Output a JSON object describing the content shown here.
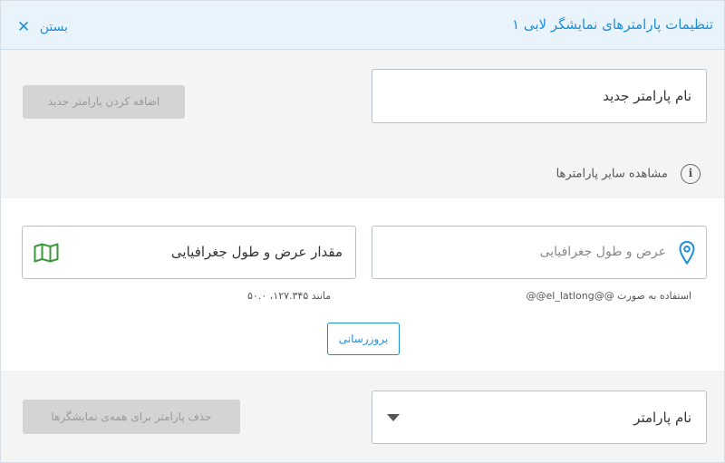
{
  "header": {
    "title": "تنظیمات پارامترهای نمایشگر لابی ۱",
    "close_label": "بستن"
  },
  "add_parameter": {
    "name_value": "نام پارامتر جدید",
    "add_button_label": "اضافه کردن پارامتر جدید"
  },
  "view_others": {
    "label": "مشاهده سایر پارامترها"
  },
  "latlng": {
    "field_placeholder": "عرض و طول جغرافیایی",
    "help_usage": "استفاده به صورت @@el_latlong@@",
    "value_label": "مقدار عرض و طول جغرافیایی",
    "help_example": "مانند ۱۲۷.۳۴۵، ۵۰.۰",
    "refresh_label": "بروزرسانی"
  },
  "delete": {
    "select_value": "نام پارامتر",
    "delete_button_label": "حذف پارامتر برای همه‌ی نمایشگرها"
  },
  "colors": {
    "accent": "#1e8fd7",
    "map_icon": "#3a9a3a",
    "header_bg": "#e8f3fb"
  },
  "icons": {
    "close": "close-icon",
    "info": "info-icon",
    "pin": "location-pin-icon",
    "map": "map-icon",
    "caret": "chevron-down-icon"
  }
}
